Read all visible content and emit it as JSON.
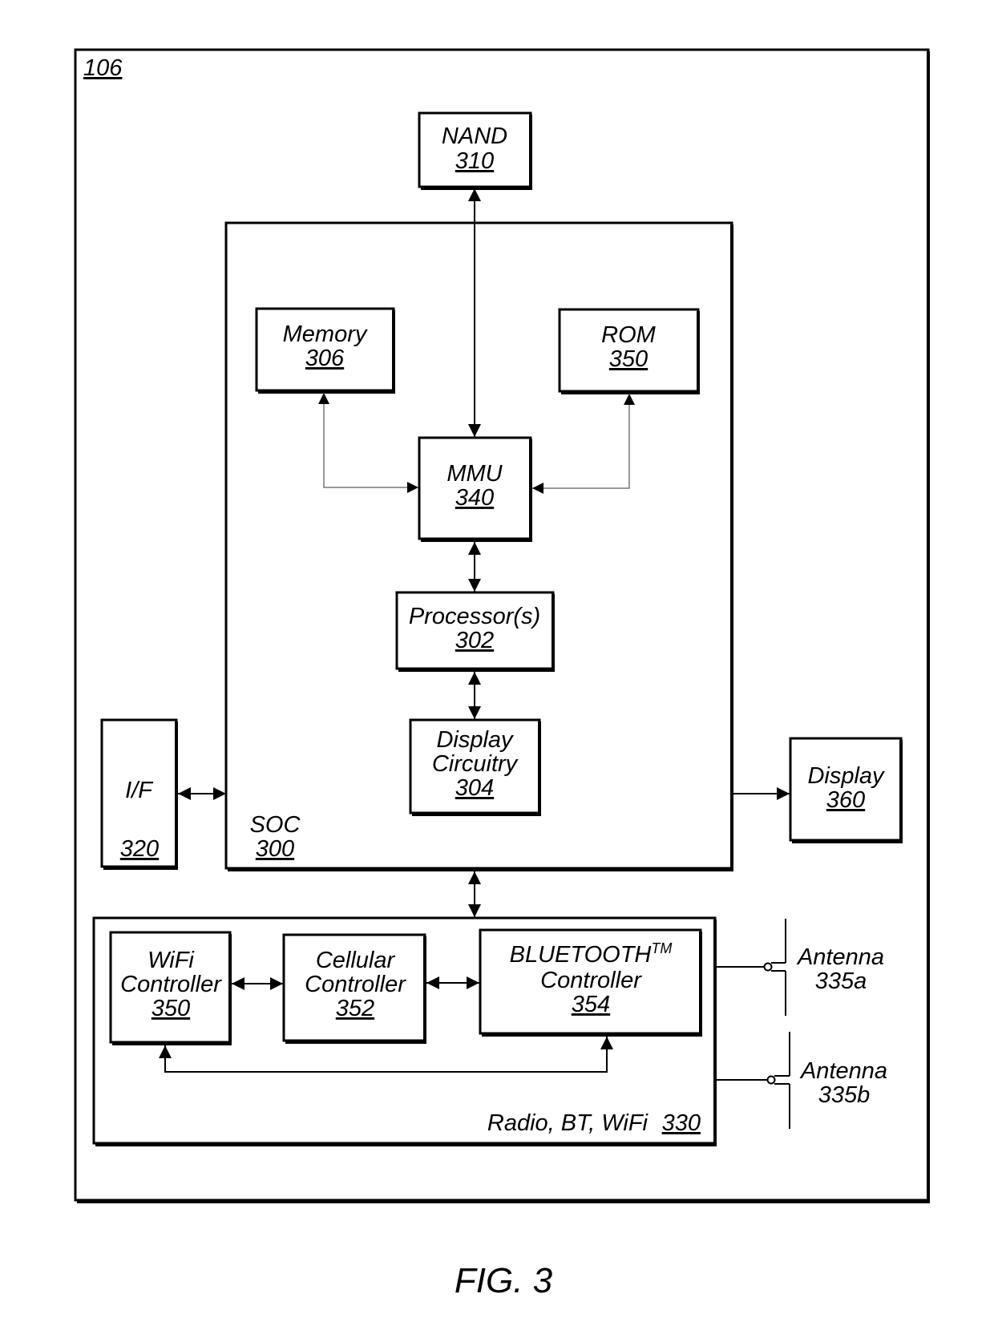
{
  "figure": {
    "ref": "106",
    "caption": "FIG. 3"
  },
  "blocks": {
    "nand": {
      "name": "NAND",
      "ref": "310"
    },
    "soc": {
      "name": "SOC",
      "ref": "300"
    },
    "memory": {
      "name": "Memory",
      "ref": "306"
    },
    "rom": {
      "name": "ROM",
      "ref": "350"
    },
    "mmu": {
      "name": "MMU",
      "ref": "340"
    },
    "processor": {
      "name": "Processor(s)",
      "ref": "302"
    },
    "display_circuitry": {
      "name_line1": "Display",
      "name_line2": "Circuitry",
      "ref": "304"
    },
    "interface": {
      "name": "I/F",
      "ref": "320"
    },
    "display": {
      "name": "Display",
      "ref": "360"
    },
    "radio": {
      "name": "Radio, BT, WiFi",
      "ref": "330"
    },
    "wifi": {
      "name_line1": "WiFi",
      "name_line2": "Controller",
      "ref": "350"
    },
    "cellular": {
      "name_line1": "Cellular",
      "name_line2": "Controller",
      "ref": "352"
    },
    "bluetooth": {
      "name_line1": "BLUETOOTH",
      "trademark": "TM",
      "name_line2": "Controller",
      "ref": "354"
    },
    "antenna_a": {
      "name": "Antenna",
      "ref": "335a"
    },
    "antenna_b": {
      "name": "Antenna",
      "ref": "335b"
    }
  },
  "connections": [
    {
      "from": "NAND",
      "to": "MMU",
      "direction": "bidirectional"
    },
    {
      "from": "Memory",
      "to": "MMU",
      "direction": "bidirectional"
    },
    {
      "from": "ROM",
      "to": "MMU",
      "direction": "bidirectional"
    },
    {
      "from": "MMU",
      "to": "Processor(s)",
      "direction": "bidirectional"
    },
    {
      "from": "Processor(s)",
      "to": "Display Circuitry",
      "direction": "bidirectional"
    },
    {
      "from": "I/F",
      "to": "SOC",
      "direction": "bidirectional"
    },
    {
      "from": "SOC",
      "to": "Display",
      "direction": "unidirectional"
    },
    {
      "from": "SOC",
      "to": "Radio, BT, WiFi",
      "direction": "bidirectional"
    },
    {
      "from": "WiFi Controller",
      "to": "Cellular Controller",
      "direction": "bidirectional"
    },
    {
      "from": "Cellular Controller",
      "to": "BLUETOOTH Controller",
      "direction": "bidirectional"
    },
    {
      "from": "WiFi Controller",
      "to": "BLUETOOTH Controller",
      "direction": "bidirectional"
    },
    {
      "from": "Radio, BT, WiFi",
      "to": "Antenna 335a",
      "direction": "line"
    },
    {
      "from": "Radio, BT, WiFi",
      "to": "Antenna 335b",
      "direction": "line"
    }
  ]
}
